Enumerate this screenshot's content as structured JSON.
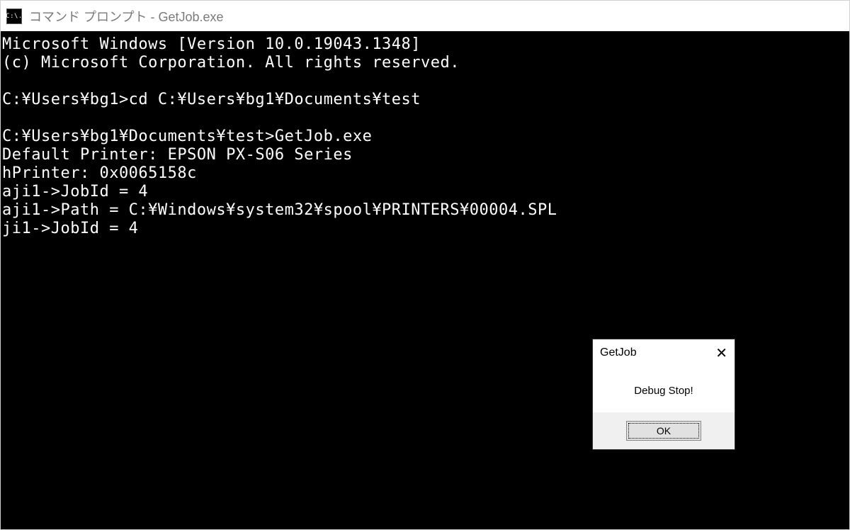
{
  "window": {
    "title": "コマンド プロンプト - GetJob.exe",
    "icon_label": "C:\\."
  },
  "terminal": {
    "lines": [
      "Microsoft Windows [Version 10.0.19043.1348]",
      "(c) Microsoft Corporation. All rights reserved.",
      "",
      "C:¥Users¥bg1>cd C:¥Users¥bg1¥Documents¥test",
      "",
      "C:¥Users¥bg1¥Documents¥test>GetJob.exe",
      "Default Printer: EPSON PX-S06 Series",
      "hPrinter: 0x0065158c",
      "aji1->JobId = 4",
      "aji1->Path = C:¥Windows¥system32¥spool¥PRINTERS¥00004.SPL",
      "ji1->JobId = 4"
    ]
  },
  "dialog": {
    "title": "GetJob",
    "message": "Debug Stop!",
    "ok_label": "OK"
  }
}
